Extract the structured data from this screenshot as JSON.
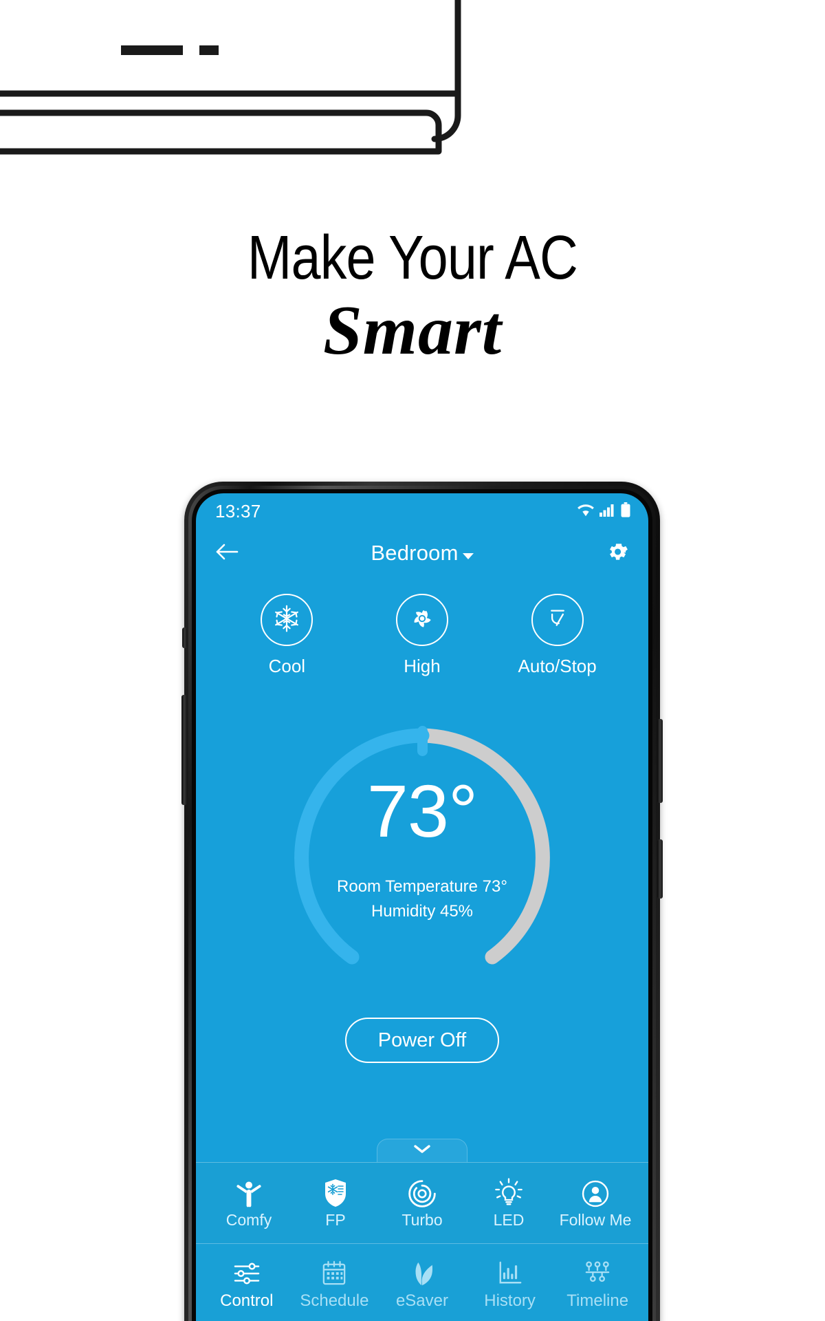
{
  "hero": {
    "illustration": "air-conditioner-line-art",
    "headline_line1": "Make Your AC",
    "headline_line2": "Smart"
  },
  "colors": {
    "brand_blue": "#17a0da",
    "panel_blue": "#1a9fd4",
    "nav_blue": "#19a0d6",
    "arc_active": "#35b4ec",
    "arc_track": "#cdcdcd",
    "text_white": "#ffffff",
    "nav_inactive": "#a8dff5"
  },
  "phone": {
    "status_bar": {
      "time": "13:37",
      "icons": [
        "wifi-icon",
        "cellular-signal-icon",
        "battery-icon"
      ]
    },
    "app_bar": {
      "back_icon": "arrow-left-icon",
      "title": "Bedroom",
      "dropdown_icon": "caret-down-icon",
      "settings_icon": "gear-icon"
    },
    "modes": [
      {
        "label": "Cool",
        "icon": "snowflake-icon"
      },
      {
        "label": "High",
        "icon": "fan-icon"
      },
      {
        "label": "Auto/Stop",
        "icon": "swing-louver-icon"
      }
    ],
    "dial": {
      "set_temperature": "73°",
      "room_temperature_line": "Room Temperature 73°",
      "humidity_line": "Humidity 45%",
      "arc_active_percent": 58,
      "handle_icon": "dial-handle"
    },
    "power_button": {
      "label": "Power Off"
    },
    "drawer": {
      "expand_icon": "chevron-down-icon"
    },
    "features": [
      {
        "label": "Comfy",
        "icon": "person-comfort-icon"
      },
      {
        "label": "FP",
        "icon": "freeze-protection-shield-icon"
      },
      {
        "label": "Turbo",
        "icon": "turbo-swirl-icon"
      },
      {
        "label": "LED",
        "icon": "lightbulb-icon"
      },
      {
        "label": "Follow Me",
        "icon": "person-badge-icon"
      }
    ],
    "bottom_nav": [
      {
        "label": "Control",
        "icon": "sliders-icon",
        "active": true
      },
      {
        "label": "Schedule",
        "icon": "calendar-icon",
        "active": false
      },
      {
        "label": "eSaver",
        "icon": "leaf-icon",
        "active": false
      },
      {
        "label": "History",
        "icon": "bar-chart-icon",
        "active": false
      },
      {
        "label": "Timeline",
        "icon": "timeline-icon",
        "active": false
      }
    ]
  }
}
